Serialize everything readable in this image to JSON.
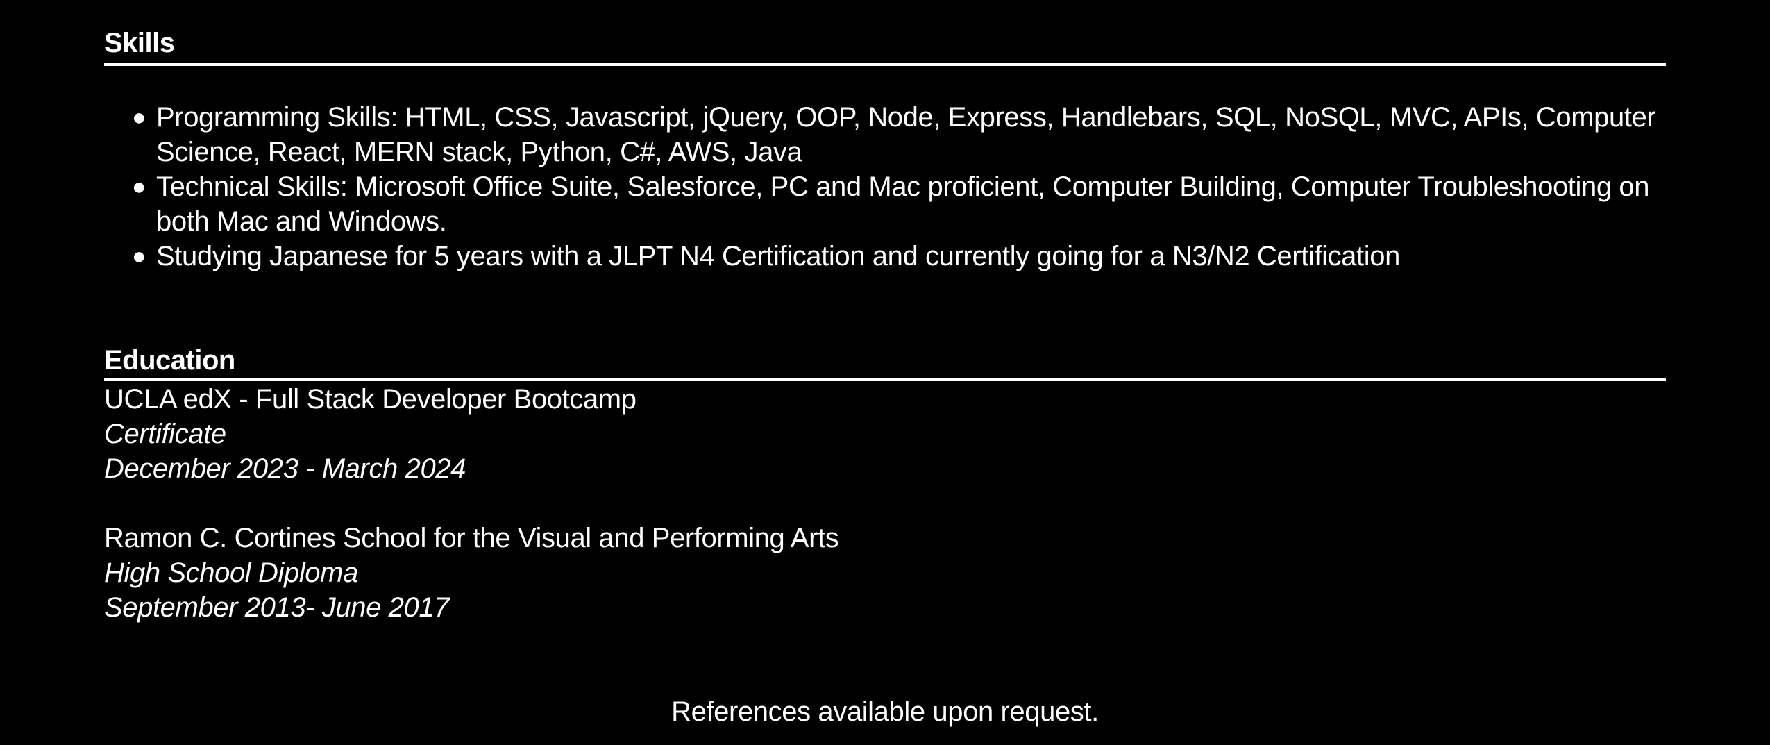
{
  "skills": {
    "title": "Skills",
    "items": [
      "Programming Skills: HTML, CSS, Javascript, jQuery, OOP, Node, Express, Handlebars, SQL, NoSQL, MVC, APIs, Computer Science, React, MERN stack, Python, C#, AWS, Java",
      "Technical Skills: Microsoft Office Suite, Salesforce, PC and Mac proficient, Computer Building, Computer Troubleshooting on both Mac and Windows.",
      "Studying Japanese for 5 years with a JLPT N4 Certification and currently going for a N3/N2 Certification"
    ],
    "bullet": "●"
  },
  "education": {
    "title": "Education",
    "entries": [
      {
        "school": "UCLA edX - Full Stack Developer Bootcamp",
        "credential": "Certificate",
        "dates": "December 2023 - March 2024"
      },
      {
        "school": "Ramon C. Cortines School for the Visual and Performing Arts",
        "credential": "High School Diploma",
        "dates": "September 2013- June 2017"
      }
    ]
  },
  "footer": {
    "references": "References available upon request."
  },
  "colors": {
    "background": "#000000",
    "text": "#ffffff"
  }
}
